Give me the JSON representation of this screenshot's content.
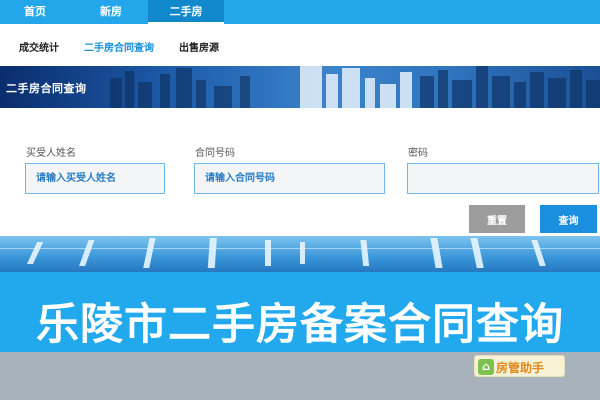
{
  "topnav": {
    "items": [
      {
        "label": "首页"
      },
      {
        "label": "新房"
      },
      {
        "label": "二手房"
      }
    ]
  },
  "subnav": {
    "items": [
      {
        "label": "成交统计"
      },
      {
        "label": "二手房合同查询"
      },
      {
        "label": "出售房源"
      }
    ]
  },
  "banner": {
    "title": "二手房合同查询"
  },
  "form": {
    "buyer": {
      "label": "买受人姓名",
      "placeholder": "请输入买受人姓名",
      "value": ""
    },
    "contract": {
      "label": "合同号码",
      "placeholder": "请输入合同号码",
      "value": ""
    },
    "password": {
      "label": "密码",
      "placeholder": "",
      "value": ""
    },
    "reset_label": "重置",
    "search_label": "查询"
  },
  "caption": {
    "title": "乐陵市二手房备案合同查询"
  },
  "badge": {
    "text": "房管助手"
  },
  "colors": {
    "accent": "#23a7ea",
    "button_primary": "#1a8fe0",
    "button_reset": "#9c9c9c"
  }
}
